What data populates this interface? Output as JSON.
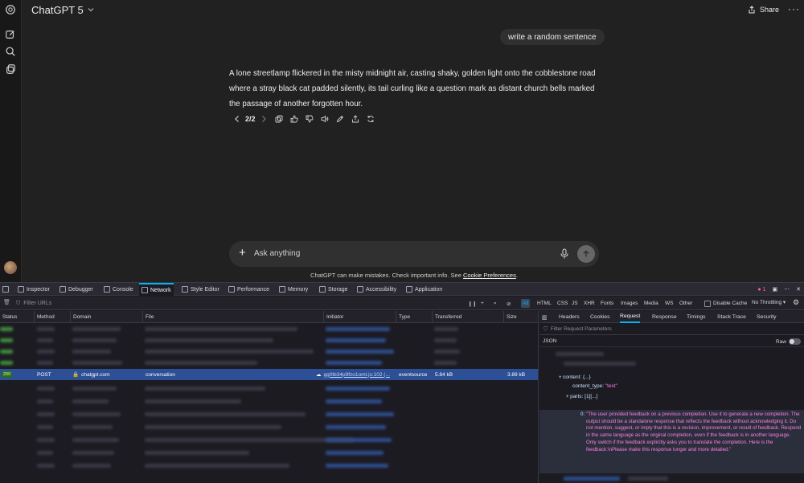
{
  "app": {
    "model_label": "ChatGPT 5",
    "share_label": "Share",
    "more_label": "···",
    "user_message": "write a random sentence",
    "assistant_message": "A lone streetlamp flickered in the misty midnight air, casting shaky, golden light onto the cobblestone road where a stray black cat padded silently, its tail curling like a question mark as distant church bells marked the passage of another forgotten hour.",
    "pager": "2/2",
    "composer_placeholder": "Ask anything",
    "composer_plus": "+",
    "disclaimer_text": "ChatGPT can make mistakes. Check important info. See ",
    "disclaimer_link": "Cookie Preferences",
    "disclaimer_end": ".",
    "icons": [
      "openai-logo-icon",
      "new-chat-icon",
      "search-icon",
      "library-icon",
      "share-icon",
      "copy-icon",
      "thumbs-up-icon",
      "thumbs-down-icon",
      "speaker-icon",
      "edit-icon",
      "share-out-icon",
      "regenerate-icon",
      "mic-icon",
      "send-icon"
    ]
  },
  "devtools": {
    "tabs": [
      "Inspector",
      "Debugger",
      "Console",
      "Network",
      "Style Editor",
      "Performance",
      "Memory",
      "Storage",
      "Accessibility",
      "Application"
    ],
    "active_tab": "Network",
    "error_count": "1",
    "filter_placeholder": "Filter URLs",
    "type_filters": [
      "All",
      "HTML",
      "CSS",
      "JS",
      "XHR",
      "Fonts",
      "Images",
      "Media",
      "WS",
      "Other"
    ],
    "disable_cache_label": "Disable Cache",
    "throttle_label": "No Throttling",
    "columns": [
      "Status",
      "Method",
      "Domain",
      "File",
      "Initiator",
      "Type",
      "Transferred",
      "Size"
    ],
    "selected_request": {
      "status": "200",
      "method": "POST",
      "domain": "chatgpt.com",
      "file": "conversation",
      "initiator": "gg0tb34p9fzo1omt.js:102 (...",
      "type": "eventsource",
      "transferred": "5.84 kB",
      "size": "3.89 kB"
    },
    "side_tabs": [
      "Headers",
      "Cookies",
      "Request",
      "Response",
      "Timings",
      "Stack Trace",
      "Security"
    ],
    "active_side_tab": "Request",
    "param_filter_placeholder": "Filter Request Parameters",
    "json_label": "JSON",
    "raw_label": "Raw",
    "json": {
      "content_line": "content: {...}",
      "content_type_key": "content_type:",
      "content_type_val": "\"text\"",
      "parts_line": "parts: [1][...]",
      "part_index": "0:",
      "part_text": "\"The user provided feedback on a previous completion. Use it to generate a new completion. The output should be a standalone response that reflects the feedback without acknowledging it. Do not mention, suggest, or imply that this is a revision, improvement, or result of feedback. Respond in the same language as the original completion, even if the feedback is in another language. Only switch if the feedback explicitly asks you to translate the completion. Here is the feedback:\\nPlease make this response longer and more detailed.\""
    },
    "colors": {
      "accent": "#00b3f4",
      "selected_row": "#2c4f95",
      "string": "#ff7de9",
      "error": "#ff6b7f"
    }
  }
}
